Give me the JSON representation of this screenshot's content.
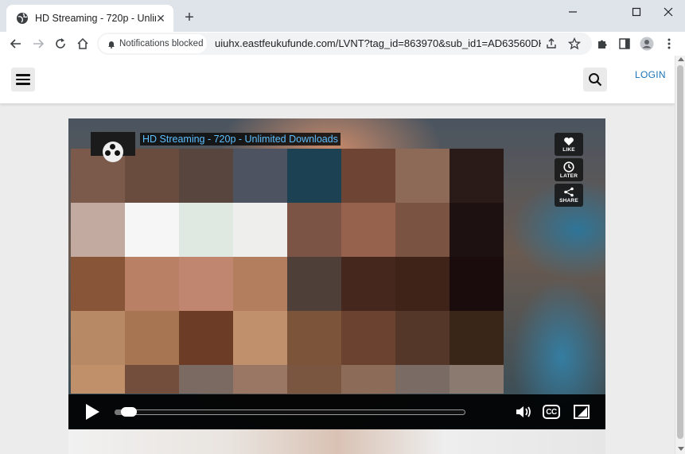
{
  "browser": {
    "tab": {
      "title": "HD Streaming - 720p - Unlimited Downloads"
    },
    "notifications_chip": "Notifications blocked",
    "url": "uiuhx.eastfeukufunde.com/LVNT?tag_id=863970&sub_id1=AD63560DK&..."
  },
  "site": {
    "login_label": "LOGIN"
  },
  "player": {
    "title": "HD Streaming - 720p - Unlimited Downloads",
    "side_buttons": [
      {
        "label": "LIKE",
        "icon": "heart-icon"
      },
      {
        "label": "LATER",
        "icon": "clock-icon"
      },
      {
        "label": "SHARE",
        "icon": "share-icon"
      }
    ],
    "progress_fraction": 0.05,
    "cc_label": "CC"
  },
  "colors": {
    "link_blue": "#1a73b8",
    "title_blue": "#5ec0ff"
  },
  "mosaic_colors": [
    "#7b5a4c",
    "#6a4c3e",
    "#58453e",
    "#4d5360",
    "#1b4152",
    "#6e4535",
    "#8d6958",
    "#2a1b18",
    "#c2aaa0",
    "#f6f6f6",
    "#e0e9e1",
    "#eeeeec",
    "#7c5446",
    "#97624d",
    "#7a5343",
    "#1e1112",
    "#885538",
    "#b98065",
    "#c18670",
    "#b37e5d",
    "#4e4038",
    "#45271e",
    "#3f2319",
    "#1a0c0c",
    "#b78a65",
    "#a87553",
    "#6d3c27",
    "#c08f6c",
    "#7c5439",
    "#6b4230",
    "#55372a",
    "#3a2519",
    "#c0906a",
    "#744e3c",
    "#7a6a62",
    "#9a7664",
    "#7a5540",
    "#8c6b58",
    "#7a6c64",
    "#8a7a70"
  ]
}
